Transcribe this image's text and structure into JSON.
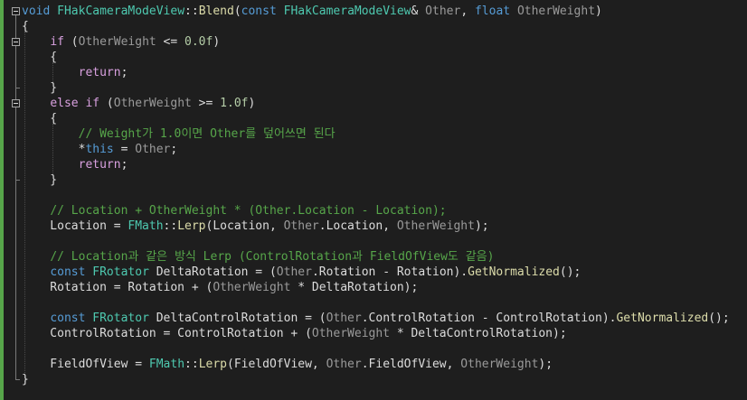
{
  "editor": {
    "lines": [
      [
        [
          "kw",
          "void"
        ],
        [
          "pl",
          " "
        ],
        [
          "ty",
          "FHakCameraModeView"
        ],
        [
          "pl",
          "::"
        ],
        [
          "fn",
          "Blend"
        ],
        [
          "pl",
          "("
        ],
        [
          "kw",
          "const"
        ],
        [
          "pl",
          " "
        ],
        [
          "ty",
          "FHakCameraModeView"
        ],
        [
          "pl",
          "& "
        ],
        [
          "par",
          "Other"
        ],
        [
          "pl",
          ", "
        ],
        [
          "kw",
          "float"
        ],
        [
          "pl",
          " "
        ],
        [
          "par",
          "OtherWeight"
        ],
        [
          "pl",
          ")"
        ]
      ],
      [
        [
          "pl",
          "{"
        ]
      ],
      [
        [
          "pl",
          "    "
        ],
        [
          "ctl",
          "if"
        ],
        [
          "pl",
          " ("
        ],
        [
          "par",
          "OtherWeight"
        ],
        [
          "pl",
          " <= "
        ],
        [
          "num",
          "0.0f"
        ],
        [
          "pl",
          ")"
        ]
      ],
      [
        [
          "pl",
          "    {"
        ]
      ],
      [
        [
          "pl",
          "        "
        ],
        [
          "ctl",
          "return"
        ],
        [
          "pl",
          ";"
        ]
      ],
      [
        [
          "pl",
          "    }"
        ]
      ],
      [
        [
          "pl",
          "    "
        ],
        [
          "ctl",
          "else"
        ],
        [
          "pl",
          " "
        ],
        [
          "ctl",
          "if"
        ],
        [
          "pl",
          " ("
        ],
        [
          "par",
          "OtherWeight"
        ],
        [
          "pl",
          " >= "
        ],
        [
          "num",
          "1.0f"
        ],
        [
          "pl",
          ")"
        ]
      ],
      [
        [
          "pl",
          "    {"
        ]
      ],
      [
        [
          "pl",
          "        "
        ],
        [
          "cm",
          "// Weight가 1.0이면 Other를 덮어쓰면 된다"
        ]
      ],
      [
        [
          "pl",
          "        *"
        ],
        [
          "kw",
          "this"
        ],
        [
          "pl",
          " = "
        ],
        [
          "par",
          "Other"
        ],
        [
          "pl",
          ";"
        ]
      ],
      [
        [
          "pl",
          "        "
        ],
        [
          "ctl",
          "return"
        ],
        [
          "pl",
          ";"
        ]
      ],
      [
        [
          "pl",
          "    }"
        ]
      ],
      [
        [
          "pl",
          ""
        ]
      ],
      [
        [
          "pl",
          "    "
        ],
        [
          "cm",
          "// Location + OtherWeight * (Other.Location - Location);"
        ]
      ],
      [
        [
          "pl",
          "    Location = "
        ],
        [
          "ty",
          "FMath"
        ],
        [
          "pl",
          "::"
        ],
        [
          "fn",
          "Lerp"
        ],
        [
          "pl",
          "(Location, "
        ],
        [
          "par",
          "Other"
        ],
        [
          "pl",
          ".Location, "
        ],
        [
          "par",
          "OtherWeight"
        ],
        [
          "pl",
          ");"
        ]
      ],
      [
        [
          "pl",
          ""
        ]
      ],
      [
        [
          "pl",
          "    "
        ],
        [
          "cm",
          "// Location과 같은 방식 Lerp (ControlRotation과 FieldOfView도 같음)"
        ]
      ],
      [
        [
          "pl",
          "    "
        ],
        [
          "kw",
          "const"
        ],
        [
          "pl",
          " "
        ],
        [
          "ty",
          "FRotator"
        ],
        [
          "pl",
          " "
        ],
        [
          "pl",
          "DeltaRotation = ("
        ],
        [
          "par",
          "Other"
        ],
        [
          "pl",
          ".Rotation - Rotation)."
        ],
        [
          "fn",
          "GetNormalized"
        ],
        [
          "pl",
          "();"
        ]
      ],
      [
        [
          "pl",
          "    Rotation = Rotation + ("
        ],
        [
          "par",
          "OtherWeight"
        ],
        [
          "pl",
          " * DeltaRotation);"
        ]
      ],
      [
        [
          "pl",
          ""
        ]
      ],
      [
        [
          "pl",
          "    "
        ],
        [
          "kw",
          "const"
        ],
        [
          "pl",
          " "
        ],
        [
          "ty",
          "FRotator"
        ],
        [
          "pl",
          " "
        ],
        [
          "pl",
          "DeltaControlRotation = ("
        ],
        [
          "par",
          "Other"
        ],
        [
          "pl",
          ".ControlRotation - ControlRotation)."
        ],
        [
          "fn",
          "GetNormalized"
        ],
        [
          "pl",
          "();"
        ]
      ],
      [
        [
          "pl",
          "    ControlRotation = ControlRotation + ("
        ],
        [
          "par",
          "OtherWeight"
        ],
        [
          "pl",
          " * DeltaControlRotation);"
        ]
      ],
      [
        [
          "pl",
          ""
        ]
      ],
      [
        [
          "pl",
          "    FieldOfView = "
        ],
        [
          "ty",
          "FMath"
        ],
        [
          "pl",
          "::"
        ],
        [
          "fn",
          "Lerp"
        ],
        [
          "pl",
          "(FieldOfView, "
        ],
        [
          "par",
          "Other"
        ],
        [
          "pl",
          ".FieldOfView, "
        ],
        [
          "par",
          "OtherWeight"
        ],
        [
          "pl",
          ");"
        ]
      ],
      [
        [
          "pl",
          "}"
        ]
      ]
    ]
  },
  "colors": {
    "background": "#1e1e1e",
    "keyword": "#569cd6",
    "control": "#d8a0df",
    "type": "#4ec9b0",
    "function": "#dcdcaa",
    "parameter": "#9a9a9a",
    "number": "#b5cea8",
    "comment": "#57a64a",
    "change_bar": "#57a64a"
  },
  "gutter": {
    "fold_markers": [
      "collapse-icon",
      "collapse-icon",
      "collapse-icon"
    ]
  }
}
